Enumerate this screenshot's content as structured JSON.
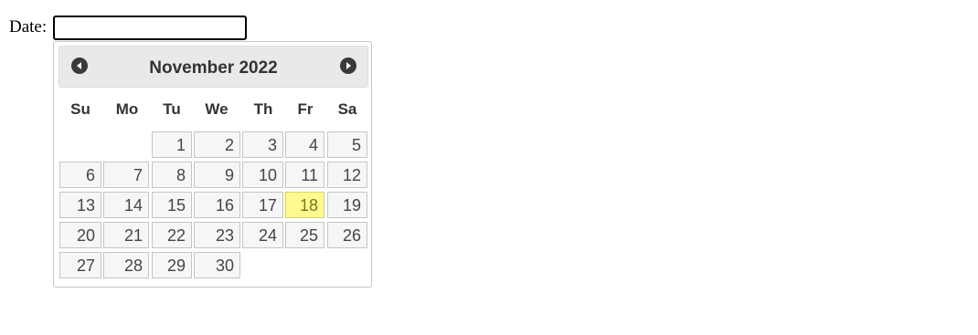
{
  "form": {
    "date_label": "Date:",
    "date_value": ""
  },
  "datepicker": {
    "month_year": "November 2022",
    "prev_icon": "circle-triangle-left-icon",
    "next_icon": "circle-triangle-right-icon",
    "day_names": [
      "Su",
      "Mo",
      "Tu",
      "We",
      "Th",
      "Fr",
      "Sa"
    ],
    "weeks": [
      [
        "",
        "",
        "1",
        "2",
        "3",
        "4",
        "5"
      ],
      [
        "6",
        "7",
        "8",
        "9",
        "10",
        "11",
        "12"
      ],
      [
        "13",
        "14",
        "15",
        "16",
        "17",
        "18",
        "19"
      ],
      [
        "20",
        "21",
        "22",
        "23",
        "24",
        "25",
        "26"
      ],
      [
        "27",
        "28",
        "29",
        "30",
        "",
        "",
        ""
      ]
    ],
    "highlighted_day": "18",
    "colors": {
      "highlight_bg": "#fffa90",
      "highlight_border": "#dad55e",
      "cell_bg": "#f6f6f6",
      "header_bg": "#e9e9e9"
    }
  }
}
